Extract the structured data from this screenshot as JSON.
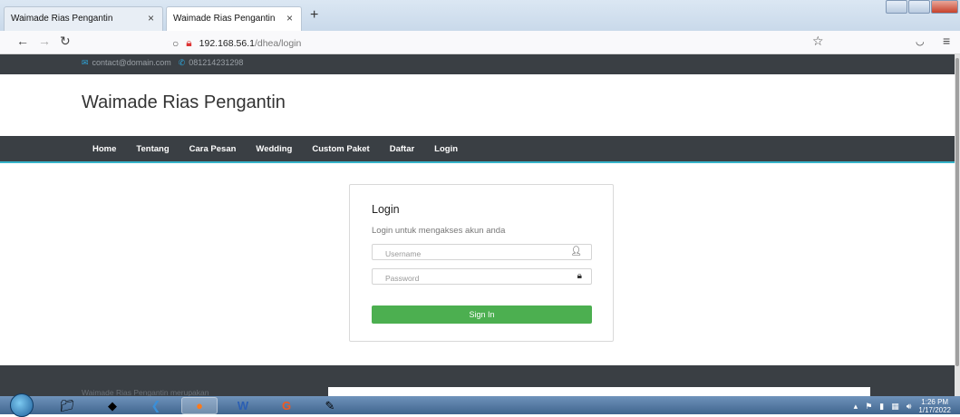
{
  "browser": {
    "tabs": [
      {
        "label": "Waimade Rias Pengantin"
      },
      {
        "label": "Waimade Rias Pengantin"
      }
    ],
    "url_host": "192.168.56.1",
    "url_path": "/dhea/login"
  },
  "topbar": {
    "email": "contact@domain.com",
    "phone": "081214231298"
  },
  "site": {
    "brand": "Waimade Rias Pengantin"
  },
  "nav": {
    "items": [
      "Home",
      "Tentang",
      "Cara Pesan",
      "Wedding",
      "Custom Paket",
      "Daftar",
      "Login"
    ]
  },
  "login": {
    "title": "Login",
    "subtitle": "Login untuk mengakses akun anda",
    "username_placeholder": "Username",
    "password_placeholder": "Password",
    "submit_label": "Sign In"
  },
  "footer": {
    "text": "Waimade Rias Pengantin merupakan"
  },
  "taskbar": {
    "time": "1:26 PM",
    "date": "1/17/2022"
  },
  "colors": {
    "dark_bar": "#3a3f44",
    "accent_line": "#36b3c9",
    "button_green": "#4caf50"
  }
}
